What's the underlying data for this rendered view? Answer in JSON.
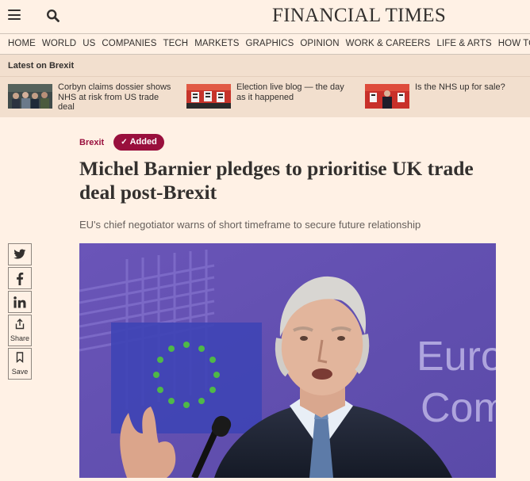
{
  "header": {
    "brand": "FINANCIAL TIMES",
    "menu_icon": "hamburger-menu-icon",
    "search_icon": "search-icon"
  },
  "nav": {
    "items": [
      "HOME",
      "WORLD",
      "US",
      "COMPANIES",
      "TECH",
      "MARKETS",
      "GRAPHICS",
      "OPINION",
      "WORK & CAREERS",
      "LIFE & ARTS",
      "HOW TO SPEND IT"
    ]
  },
  "latest": {
    "title": "Latest on Brexit",
    "stories": [
      {
        "headline": "Corbyn claims dossier shows NHS at risk from US trade deal"
      },
      {
        "headline": "Election live blog — the day as it happened"
      },
      {
        "headline": "Is the NHS up for sale?"
      }
    ]
  },
  "article": {
    "topic": "Brexit",
    "added_label": "Added",
    "headline": "Michel Barnier pledges to prioritise UK trade deal post-Brexit",
    "standfirst": "EU's chief negotiator warns of short timeframe to secure future relationship"
  },
  "share": {
    "twitter_icon": "twitter-icon",
    "facebook_icon": "facebook-icon",
    "linkedin_icon": "linkedin-icon",
    "share_label": "Share",
    "save_label": "Save"
  },
  "hero": {
    "banner_text_line1": "Euro",
    "banner_text_line2": "Com"
  },
  "colors": {
    "background": "#fff1e5",
    "latest_band": "#f2dfce",
    "accent_claret": "#990f3d",
    "hero_purple": "#6a55b8"
  }
}
